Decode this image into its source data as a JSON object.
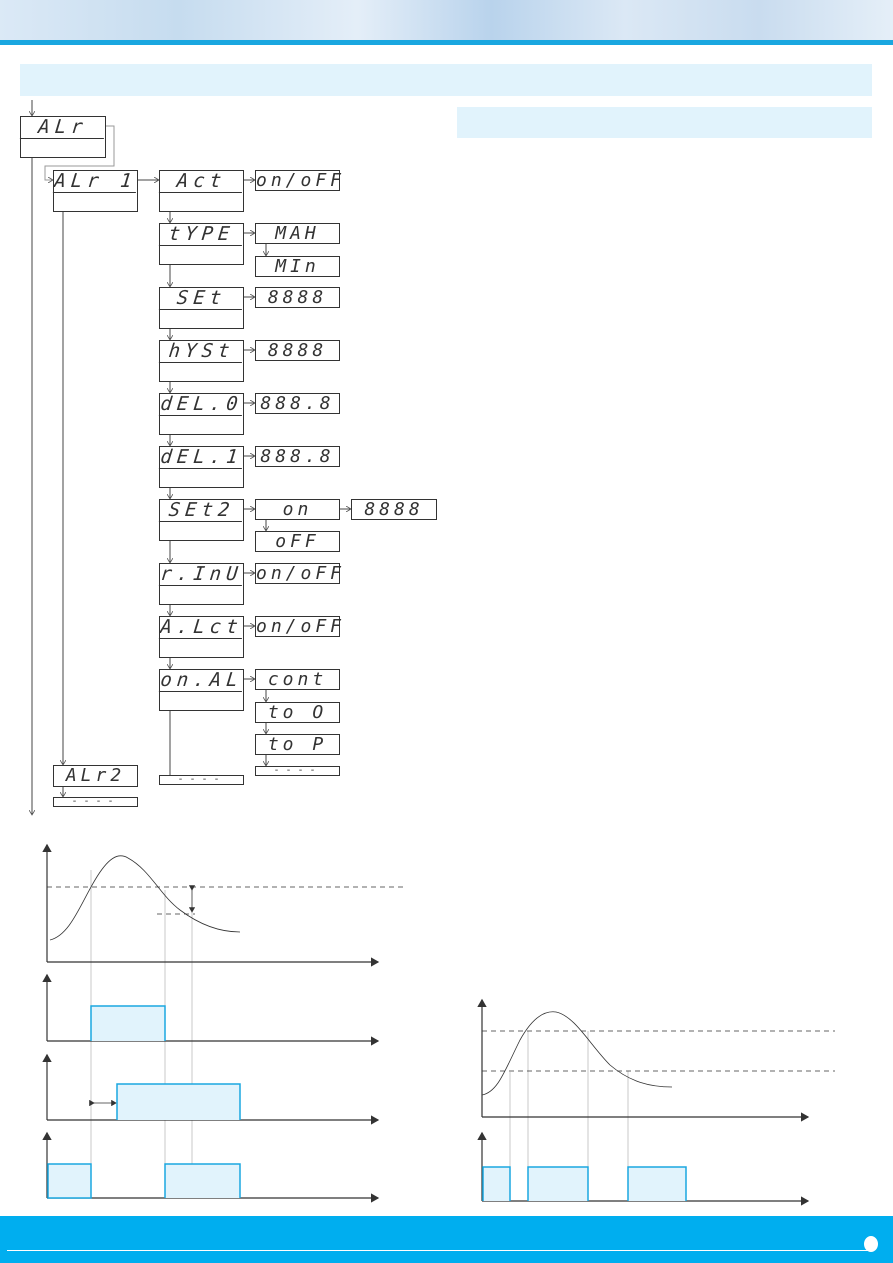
{
  "colors": {
    "accent": "#00aeef",
    "band": "#e1f3fc",
    "pulse_fill": "#e1f3fc",
    "pulse_stroke": "#1aa7e0"
  },
  "menu": {
    "root": "ALr",
    "alarm1": "ALr 1",
    "alarm2": "ALr2",
    "end": "----",
    "params": [
      {
        "label": "Act",
        "values": [
          "on/oFF"
        ]
      },
      {
        "label": "tYPE",
        "values": [
          "MAH",
          "MIn"
        ]
      },
      {
        "label": "SEt",
        "values": [
          "8888"
        ]
      },
      {
        "label": "hYSt",
        "values": [
          "8888"
        ]
      },
      {
        "label": "dEL.0",
        "values": [
          "888.8"
        ]
      },
      {
        "label": "dEL.1",
        "values": [
          "888.8"
        ]
      },
      {
        "label": "SEt2",
        "values": [
          "on",
          "oFF"
        ],
        "sub_value": "8888"
      },
      {
        "label": "r.InU",
        "values": [
          "on/oFF"
        ]
      },
      {
        "label": "A.Lct",
        "values": [
          "on/oFF"
        ]
      },
      {
        "label": "on.AL",
        "values": [
          "cont",
          "to O",
          "to P"
        ]
      }
    ]
  }
}
